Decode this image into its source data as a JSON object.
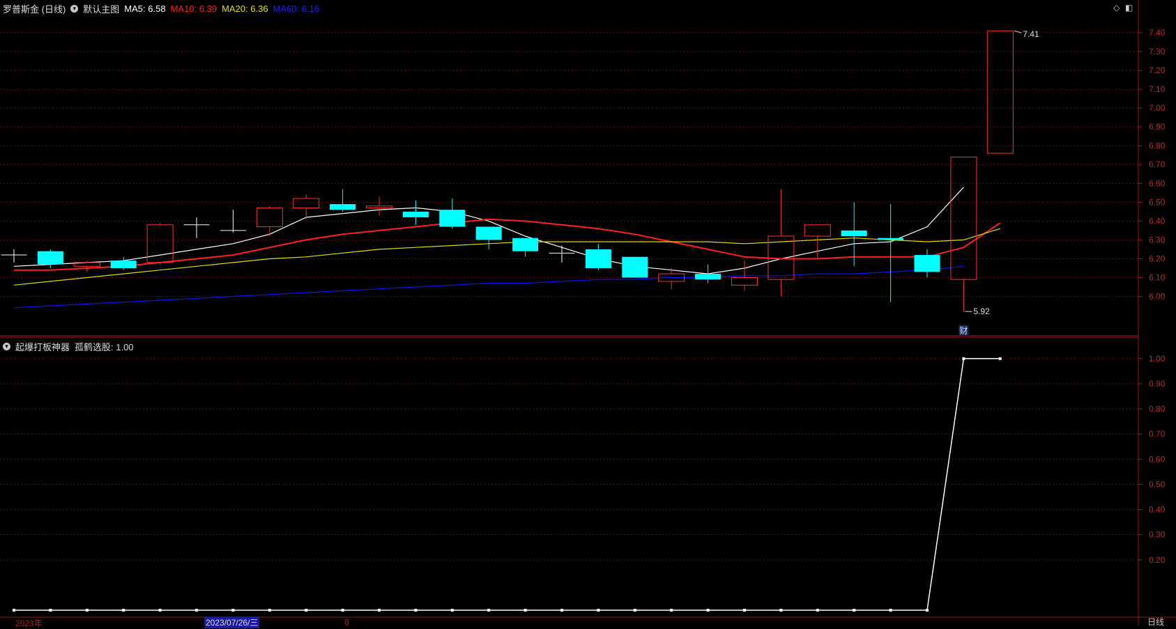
{
  "top_header": {
    "stock_name": "罗普斯金 (日线)",
    "indicator_label": "默认主图",
    "ma5_label": "MA5: 6.58",
    "ma10_label": "MA10: 6.39",
    "ma20_label": "MA20: 6.36",
    "ma60_label": "MA60: 6.16",
    "colors": {
      "ma5": "#ffffff",
      "ma10": "#ff2020",
      "ma20": "#e0e000",
      "ma60": "#1010ff"
    },
    "toolbar_icons": [
      "diamond-icon",
      "panel-toggle-icon"
    ]
  },
  "sub_header": {
    "title": "起爆打板神器",
    "value_label": "孤鹤选股: 1.00"
  },
  "chart_data": [
    {
      "type": "candlestick",
      "title": "罗普斯金 (日线)",
      "ylim": [
        5.88,
        7.47
      ],
      "y_ticks": [
        "7.40",
        "7.30",
        "7.20",
        "7.10",
        "7.00",
        "6.90",
        "6.80",
        "6.70",
        "6.60",
        "6.50",
        "6.40",
        "6.30",
        "6.20",
        "6.10",
        "6.00"
      ],
      "candles": [
        {
          "o": 6.22,
          "h": 6.25,
          "l": 6.18,
          "c": 6.22
        },
        {
          "o": 6.24,
          "h": 6.25,
          "l": 6.15,
          "c": 6.17
        },
        {
          "o": 6.16,
          "h": 6.19,
          "l": 6.13,
          "c": 6.18
        },
        {
          "o": 6.19,
          "h": 6.21,
          "l": 6.14,
          "c": 6.15
        },
        {
          "o": 6.18,
          "h": 6.39,
          "l": 6.17,
          "c": 6.38
        },
        {
          "o": 6.38,
          "h": 6.42,
          "l": 6.31,
          "c": 6.38
        },
        {
          "o": 6.35,
          "h": 6.46,
          "l": 6.34,
          "c": 6.35
        },
        {
          "o": 6.37,
          "h": 6.48,
          "l": 6.32,
          "c": 6.47
        },
        {
          "o": 6.47,
          "h": 6.54,
          "l": 6.41,
          "c": 6.52
        },
        {
          "o": 6.49,
          "h": 6.57,
          "l": 6.45,
          "c": 6.46
        },
        {
          "o": 6.47,
          "h": 6.53,
          "l": 6.43,
          "c": 6.48
        },
        {
          "o": 6.45,
          "h": 6.51,
          "l": 6.38,
          "c": 6.42
        },
        {
          "o": 6.46,
          "h": 6.52,
          "l": 6.36,
          "c": 6.37
        },
        {
          "o": 6.37,
          "h": 6.37,
          "l": 6.25,
          "c": 6.3
        },
        {
          "o": 6.31,
          "h": 6.31,
          "l": 6.21,
          "c": 6.24
        },
        {
          "o": 6.23,
          "h": 6.27,
          "l": 6.18,
          "c": 6.23
        },
        {
          "o": 6.25,
          "h": 6.28,
          "l": 6.14,
          "c": 6.15
        },
        {
          "o": 6.21,
          "h": 6.21,
          "l": 6.1,
          "c": 6.1
        },
        {
          "o": 6.08,
          "h": 6.15,
          "l": 6.04,
          "c": 6.12
        },
        {
          "o": 6.12,
          "h": 6.17,
          "l": 6.07,
          "c": 6.09
        },
        {
          "o": 6.06,
          "h": 6.19,
          "l": 6.03,
          "c": 6.1
        },
        {
          "o": 6.09,
          "h": 6.57,
          "l": 6.0,
          "c": 6.32
        },
        {
          "o": 6.32,
          "h": 6.38,
          "l": 6.2,
          "c": 6.38
        },
        {
          "o": 6.35,
          "h": 6.5,
          "l": 6.16,
          "c": 6.32
        },
        {
          "o": 6.31,
          "h": 6.49,
          "l": 5.97,
          "c": 6.3
        },
        {
          "o": 6.22,
          "h": 6.25,
          "l": 6.1,
          "c": 6.13
        },
        {
          "o": 6.09,
          "h": 6.74,
          "l": 5.92,
          "c": 6.74
        },
        {
          "o": 6.76,
          "h": 7.41,
          "l": 6.76,
          "c": 7.41
        }
      ],
      "ma_series": [
        {
          "name": "MA5",
          "color": "#ffffff",
          "values": [
            6.16,
            6.17,
            6.18,
            6.19,
            6.22,
            6.25,
            6.28,
            6.33,
            6.42,
            6.44,
            6.46,
            6.47,
            6.45,
            6.4,
            6.32,
            6.26,
            6.2,
            6.16,
            6.14,
            6.12,
            6.15,
            6.2,
            6.24,
            6.28,
            6.29,
            6.37,
            6.58
          ]
        },
        {
          "name": "MA10",
          "color": "#ff2020",
          "values": [
            6.14,
            6.14,
            6.15,
            6.16,
            6.18,
            6.2,
            6.22,
            6.26,
            6.3,
            6.33,
            6.35,
            6.37,
            6.39,
            6.41,
            6.4,
            6.38,
            6.36,
            6.33,
            6.29,
            6.25,
            6.21,
            6.2,
            6.2,
            6.21,
            6.21,
            6.21,
            6.26,
            6.39
          ]
        },
        {
          "name": "MA20",
          "color": "#e0e000",
          "values": [
            6.06,
            6.08,
            6.1,
            6.12,
            6.14,
            6.16,
            6.18,
            6.2,
            6.21,
            6.23,
            6.25,
            6.26,
            6.27,
            6.28,
            6.29,
            6.29,
            6.29,
            6.29,
            6.29,
            6.29,
            6.28,
            6.29,
            6.3,
            6.31,
            6.3,
            6.29,
            6.3,
            6.36
          ]
        },
        {
          "name": "MA60",
          "color": "#1010ff",
          "values": [
            5.94,
            5.95,
            5.96,
            5.97,
            5.98,
            5.99,
            6.0,
            6.01,
            6.02,
            6.03,
            6.04,
            6.05,
            6.06,
            6.07,
            6.07,
            6.08,
            6.09,
            6.09,
            6.1,
            6.1,
            6.11,
            6.11,
            6.12,
            6.12,
            6.13,
            6.14,
            6.16
          ]
        }
      ],
      "annotations": [
        {
          "text": "7.41",
          "candle": 27,
          "value": 7.41
        },
        {
          "text": "5.92",
          "candle": 26,
          "value": 5.92
        },
        {
          "text": "财",
          "candle": 26
        }
      ]
    },
    {
      "type": "line",
      "title": "起爆打板神器",
      "ylim": [
        0.0,
        1.03
      ],
      "y_ticks": [
        "1.00",
        "0.90",
        "0.80",
        "0.70",
        "0.60",
        "0.50",
        "0.40",
        "0.30",
        "0.20"
      ],
      "series": [
        {
          "name": "孤鹤选股",
          "color": "#ffffff",
          "values": [
            0,
            0,
            0,
            0,
            0,
            0,
            0,
            0,
            0,
            0,
            0,
            0,
            0,
            0,
            0,
            0,
            0,
            0,
            0,
            0,
            0,
            0,
            0,
            0,
            0,
            0,
            1,
            1
          ]
        }
      ]
    }
  ],
  "bottom_axis": {
    "year_label": "2023年",
    "date_label": "2023/07/26/三",
    "marker_label": "8",
    "period_label": "日线"
  }
}
